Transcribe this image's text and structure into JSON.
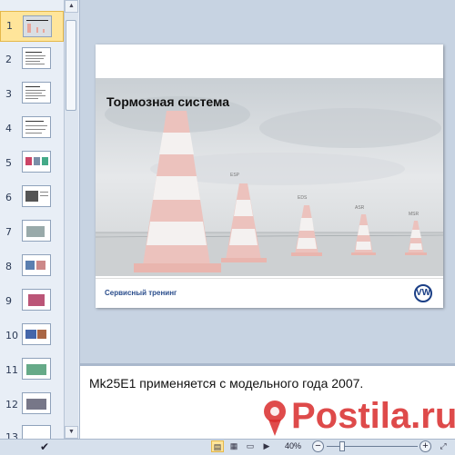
{
  "thumbnails": [
    {
      "number": "1"
    },
    {
      "number": "2"
    },
    {
      "number": "3"
    },
    {
      "number": "4"
    },
    {
      "number": "5"
    },
    {
      "number": "6"
    },
    {
      "number": "7"
    },
    {
      "number": "8"
    },
    {
      "number": "9"
    },
    {
      "number": "10"
    },
    {
      "number": "11"
    },
    {
      "number": "12"
    },
    {
      "number": "13"
    }
  ],
  "selected_slide": "1",
  "slide": {
    "title": "Тормозная система",
    "cone_labels": [
      "ESP",
      "EDS",
      "ASR",
      "MSR"
    ],
    "footer_text": "Сервисный тренинг",
    "logo": "VW"
  },
  "notes": {
    "text": "Mk25E1 применяется с модельного года 2007."
  },
  "status_bar": {
    "zoom_level": "40%",
    "zoom_out_label": "−",
    "zoom_in_label": "+"
  },
  "watermark": {
    "text": "Postila.ru",
    "color": "#d92b2b"
  },
  "icons": {
    "spellcheck": "spellcheck-icon",
    "view_normal": "normal-view-icon",
    "view_sorter": "slide-sorter-icon",
    "view_reading": "reading-view-icon",
    "view_show": "slideshow-icon"
  }
}
